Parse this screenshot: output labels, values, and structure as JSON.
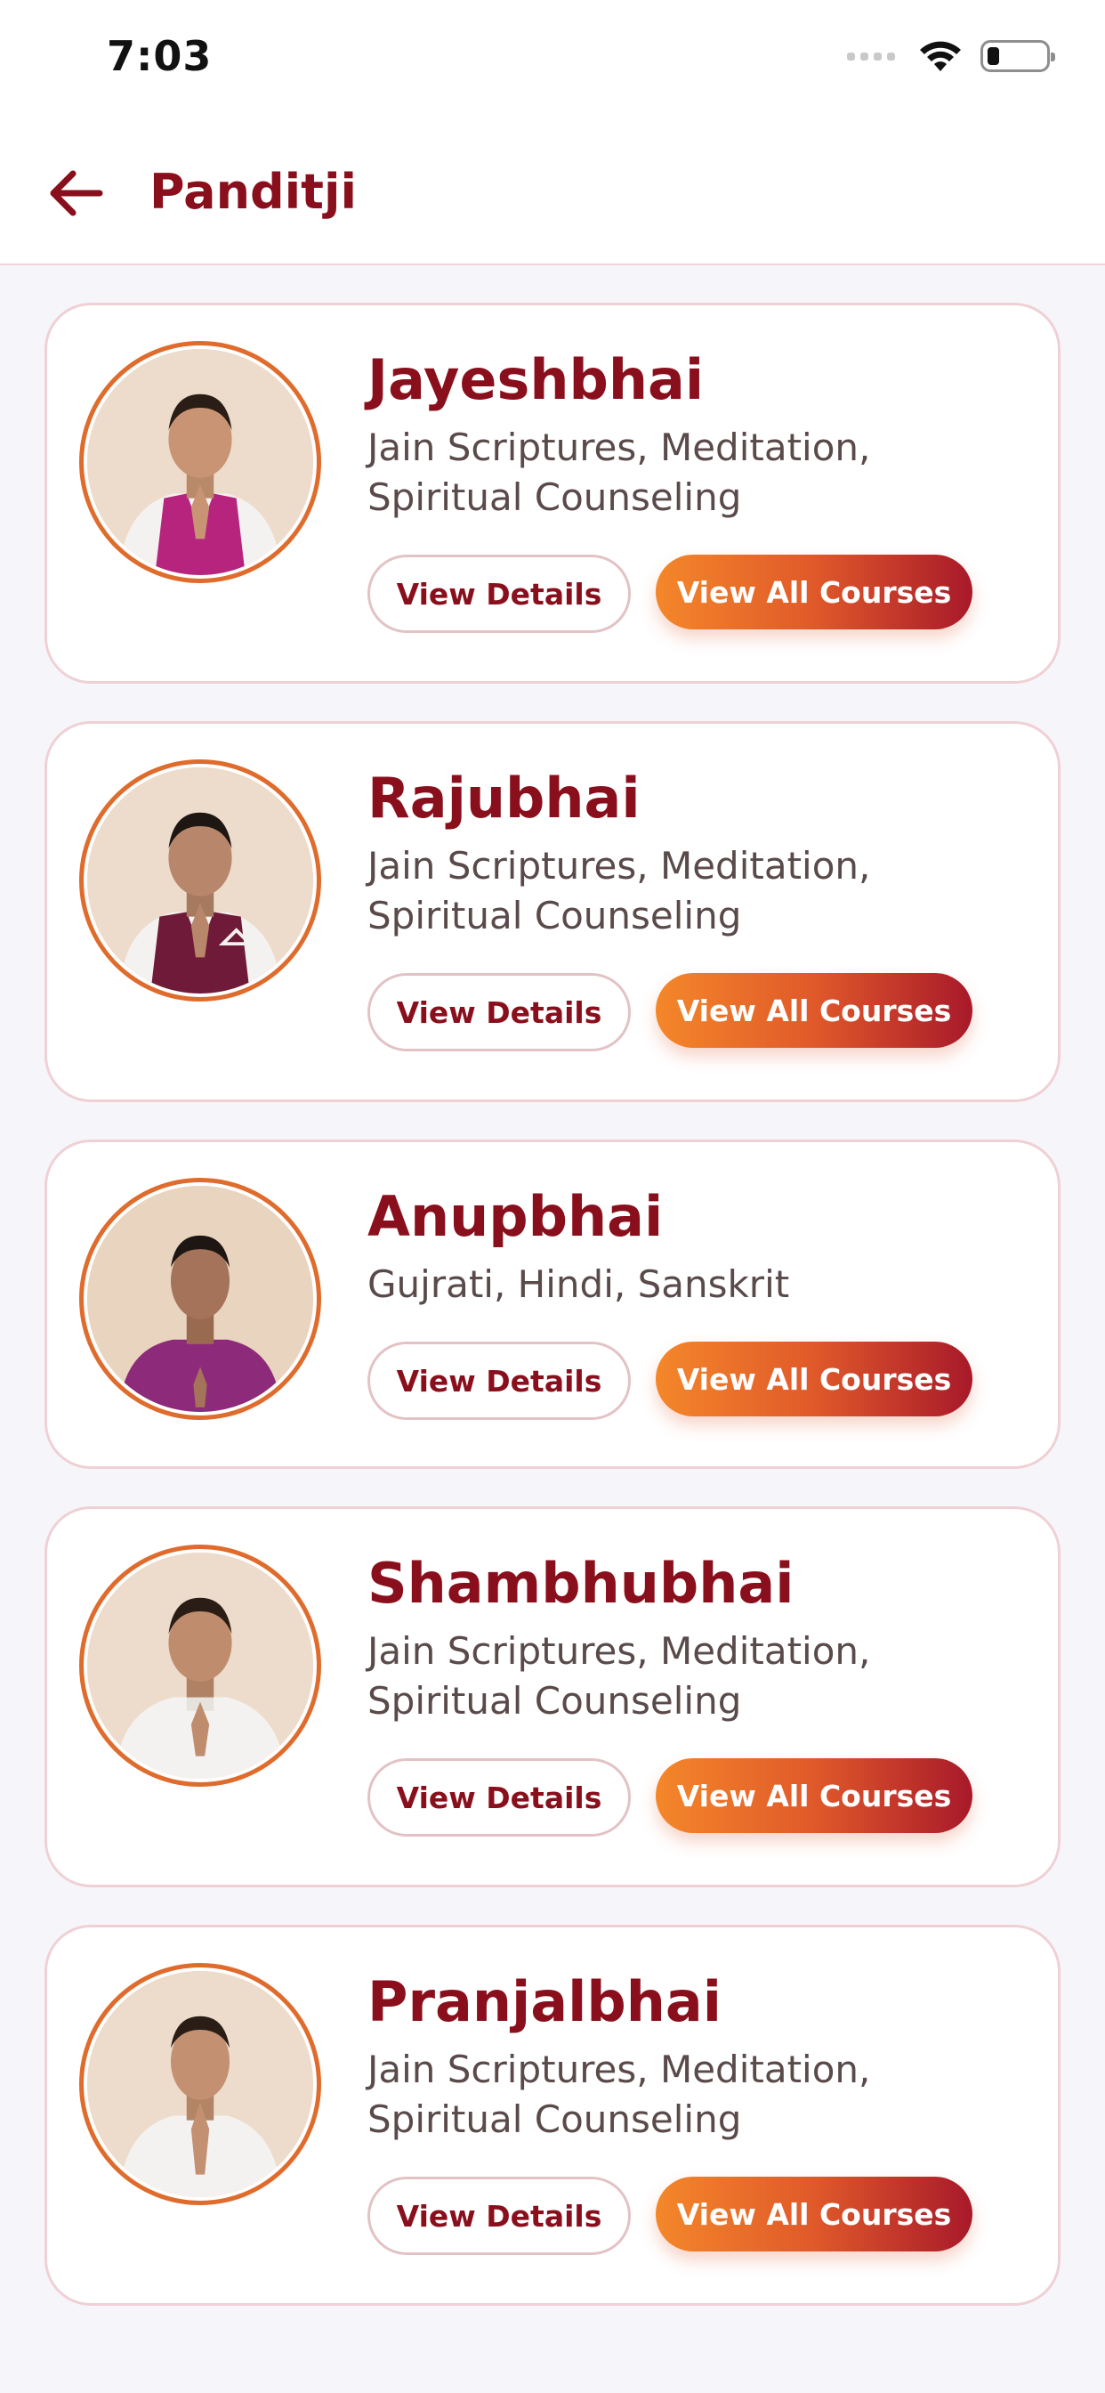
{
  "status_bar": {
    "time": "7:03",
    "icons": [
      "cellular-signal-icon",
      "wifi-icon",
      "battery-icon"
    ]
  },
  "header": {
    "back_icon": "arrow-left-icon",
    "title": "Panditji"
  },
  "colors": {
    "primary": "#8a0f1c",
    "accent_start": "#f4872a",
    "accent_end": "#a8192a",
    "card_border": "#efd1d5",
    "background": "#f6f6fa"
  },
  "panditjis": [
    {
      "name": "Jayeshbhai",
      "specialty": "Jain Scriptures, Meditation, Spiritual Counseling",
      "details_label": "View Details",
      "courses_label": "View All Courses",
      "vest_color": "#b6247e"
    },
    {
      "name": "Rajubhai",
      "specialty": "Jain Scriptures, Meditation, Spiritual Counseling",
      "details_label": "View Details",
      "courses_label": "View All Courses",
      "vest_color": "#6e1a38"
    },
    {
      "name": "Anupbhai",
      "specialty": "Gujrati, Hindi, Sanskrit",
      "details_label": "View Details",
      "courses_label": "View All Courses",
      "vest_color": "#8d2a7a"
    },
    {
      "name": "Shambhubhai",
      "specialty": "Jain Scriptures, Meditation, Spiritual Counseling",
      "details_label": "View Details",
      "courses_label": "View All Courses",
      "vest_color": "#f4f2f0"
    },
    {
      "name": "Pranjalbhai",
      "specialty": "Jain Scriptures, Meditation, Spiritual Counseling",
      "details_label": "View Details",
      "courses_label": "View All Courses",
      "vest_color": "#f4f2f0"
    }
  ]
}
